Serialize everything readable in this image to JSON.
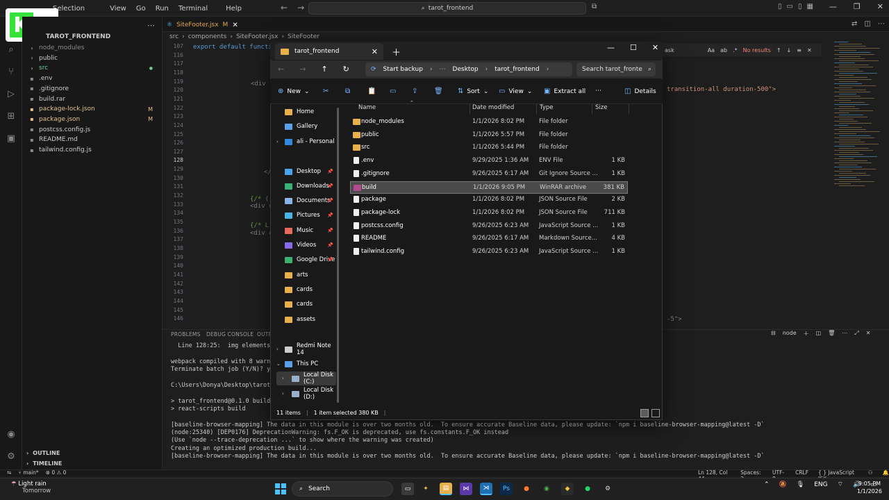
{
  "vscode": {
    "menu": [
      "Selection",
      "View",
      "Go",
      "Run",
      "Terminal",
      "Help"
    ],
    "search": "tarot_frontend",
    "explorer_header": "TAROT_FRONTEND",
    "tree": [
      {
        "name": "node_modules",
        "type": "folder",
        "mark": ""
      },
      {
        "name": "public",
        "type": "folder",
        "mark": ""
      },
      {
        "name": "src",
        "type": "folder",
        "mark": "dot"
      },
      {
        "name": ".env",
        "type": "file",
        "mark": ""
      },
      {
        "name": ".gitignore",
        "type": "file",
        "mark": ""
      },
      {
        "name": "build.rar",
        "type": "file",
        "mark": ""
      },
      {
        "name": "package-lock.json",
        "type": "file",
        "mark": "M"
      },
      {
        "name": "package.json",
        "type": "file",
        "mark": "M"
      },
      {
        "name": "postcss.config.js",
        "type": "file",
        "mark": ""
      },
      {
        "name": "README.md",
        "type": "file",
        "mark": ""
      },
      {
        "name": "tailwind.config.js",
        "type": "file",
        "mark": ""
      }
    ],
    "outline": "OUTLINE",
    "timeline": "TIMELINE",
    "active_tab": "SiteFooter.jsx",
    "active_tab_mark": "M",
    "breadcrumb": [
      "src",
      "components",
      "SiteFooter.jsx",
      "SiteFooter"
    ],
    "code_first_line": "export default functio",
    "line_numbers": [
      "107",
      "116",
      "117",
      "118",
      "119",
      "120",
      "121",
      "122",
      "123",
      "124",
      "125",
      "126",
      "127",
      "128",
      "129",
      "130",
      "131",
      "132",
      "133",
      "134",
      "135",
      "136",
      "137",
      "138",
      "139",
      "140",
      "141",
      "142",
      "143",
      "144",
      "145",
      "146"
    ],
    "code_snippets": [
      "<div c",
      "</div",
      "{/* (",
      "<div c",
      "{/* L",
      "<div c"
    ],
    "find": {
      "text": "ask",
      "result": "No results"
    },
    "code_right": "transition-all duration-500\">",
    "code_right2": "-5\">",
    "panel_tabs": [
      "PROBLEMS",
      "DEBUG CONSOLE",
      "OUTPUT"
    ],
    "terminal_label": "node",
    "terminal_lines": [
      "  Line 128:25:  img elements mu",
      "",
      "webpack compiled with 8 warning",
      "Terminate batch job (Y/N)? y",
      "",
      "C:\\Users\\Donya\\Desktop\\tarot_fr",
      "",
      "> tarot_frontend@0.1.0 build",
      "> react-scripts build",
      "",
      "[baseline-browser-mapping] The data in this module is over two months old.  To ensure accurate Baseline data, please update: `npm i baseline-browser-mapping@latest -D`",
      "(node:25340) [DEP0176] DeprecationWarning: fs.F_OK is deprecated, use fs.constants.F_OK instead",
      "(Use `node --trace-deprecation ...` to show where the warning was created)",
      "Creating an optimized production build...",
      "[baseline-browser-mapping] The data in this module is over two months old.  To ensure accurate Baseline data, please update: `npm i baseline-browser-mapping@latest -D`"
    ],
    "status": {
      "branch": "main*",
      "errors": "0",
      "warnings": "0",
      "position": "Ln 128, Col 44",
      "spaces": "Spaces: 2",
      "encoding": "UTF-8",
      "eol": "CRLF",
      "language": "JavaScript JSX"
    }
  },
  "badge": {
    "letter": "K",
    "number": "2"
  },
  "explorer": {
    "tab_title": "tarot_frontend",
    "address": [
      "Start backup",
      "Desktop",
      "tarot_frontend"
    ],
    "search_placeholder": "Search tarot_fronte",
    "commands": {
      "new": "New",
      "sort": "Sort",
      "view": "View",
      "extract": "Extract all",
      "details": "Details"
    },
    "nav": [
      {
        "label": "Home",
        "color": "#e8b04a",
        "pinned": false
      },
      {
        "label": "Gallery",
        "color": "#5aa0e8",
        "pinned": false
      },
      {
        "label": "ali - Personal",
        "color": "#2e8be0",
        "pinned": false
      },
      {
        "label": "Desktop",
        "color": "#4aa3e8",
        "pinned": true
      },
      {
        "label": "Downloads",
        "color": "#3bb273",
        "pinned": true
      },
      {
        "label": "Documents",
        "color": "#8ab4e8",
        "pinned": true
      },
      {
        "label": "Pictures",
        "color": "#4ab3e8",
        "pinned": true
      },
      {
        "label": "Music",
        "color": "#e86a5a",
        "pinned": true
      },
      {
        "label": "Videos",
        "color": "#8a6ae8",
        "pinned": true
      },
      {
        "label": "Google Drive",
        "color": "#3bb273",
        "pinned": true
      },
      {
        "label": "arts",
        "color": "#e8b04a",
        "pinned": false
      },
      {
        "label": "cards",
        "color": "#e8b04a",
        "pinned": false
      },
      {
        "label": "cards",
        "color": "#e8b04a",
        "pinned": false
      },
      {
        "label": "assets",
        "color": "#e8b04a",
        "pinned": false
      },
      {
        "label": "Redmi Note 14",
        "color": "#cccccc",
        "pinned": false
      },
      {
        "label": "This PC",
        "color": "#5aa0e8",
        "pinned": false
      },
      {
        "label": "Local Disk (C:)",
        "color": "#9ab0c8",
        "pinned": false
      },
      {
        "label": "Local Disk (D:)",
        "color": "#9ab0c8",
        "pinned": false
      }
    ],
    "columns": [
      "Name",
      "Date modified",
      "Type",
      "Size"
    ],
    "files": [
      {
        "name": "node_modules",
        "date": "1/1/2026 8:02 PM",
        "type": "File folder",
        "size": "",
        "icon": "folder"
      },
      {
        "name": "public",
        "date": "1/1/2026 5:57 PM",
        "type": "File folder",
        "size": "",
        "icon": "folder"
      },
      {
        "name": "src",
        "date": "1/1/2026 5:44 PM",
        "type": "File folder",
        "size": "",
        "icon": "folder"
      },
      {
        "name": ".env",
        "date": "9/29/2025 1:36 AM",
        "type": "ENV File",
        "size": "1 KB",
        "icon": "file"
      },
      {
        "name": ".gitignore",
        "date": "9/26/2025 6:17 AM",
        "type": "Git Ignore Source ...",
        "size": "1 KB",
        "icon": "file"
      },
      {
        "name": "build",
        "date": "1/1/2026 9:05 PM",
        "type": "WinRAR archive",
        "size": "381 KB",
        "icon": "rar"
      },
      {
        "name": "package",
        "date": "1/1/2026 8:02 PM",
        "type": "JSON Source File",
        "size": "2 KB",
        "icon": "file"
      },
      {
        "name": "package-lock",
        "date": "1/1/2026 8:02 PM",
        "type": "JSON Source File",
        "size": "711 KB",
        "icon": "file"
      },
      {
        "name": "postcss.config",
        "date": "9/26/2025 6:23 AM",
        "type": "JavaScript Source ...",
        "size": "1 KB",
        "icon": "file"
      },
      {
        "name": "README",
        "date": "9/26/2025 6:17 AM",
        "type": "Markdown Source...",
        "size": "4 KB",
        "icon": "file"
      },
      {
        "name": "tailwind.config",
        "date": "9/26/2025 6:23 AM",
        "type": "JavaScript Source ...",
        "size": "1 KB",
        "icon": "file"
      }
    ],
    "selected_file_index": 5,
    "status_items": "11 items",
    "status_selected": "1 item selected  380 KB"
  },
  "taskbar": {
    "weather_title": "Light rain",
    "weather_sub": "Tomorrow",
    "search": "Search",
    "lang": "ENG",
    "time": "9:05 PM",
    "date": "1/1/2026"
  }
}
